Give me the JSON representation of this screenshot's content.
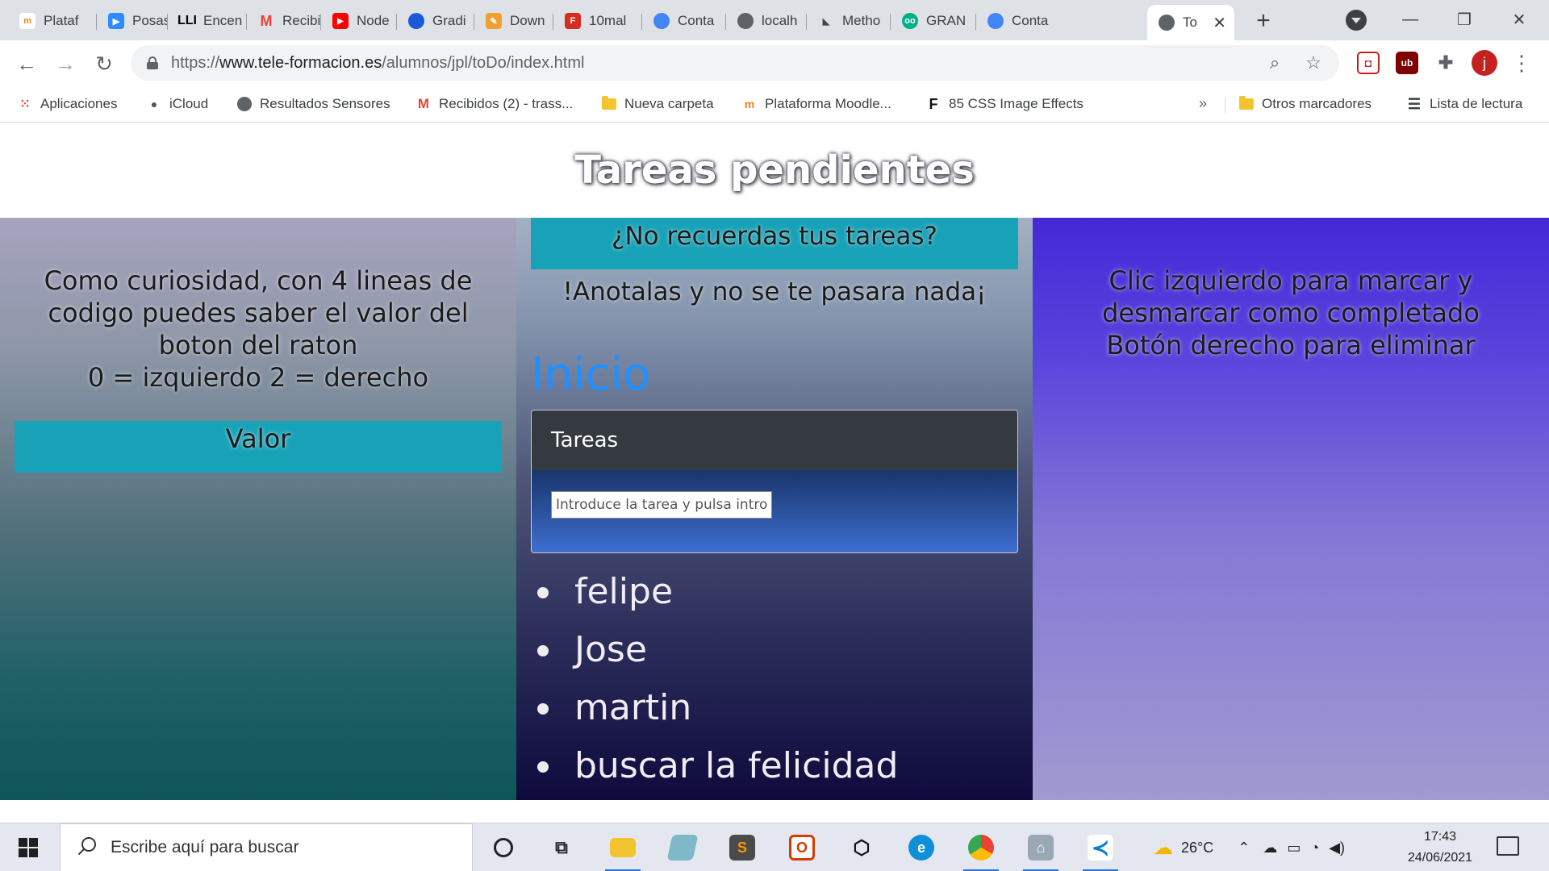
{
  "browser": {
    "tabs": [
      {
        "label": "Plataf",
        "icon": "moodle-icon",
        "color": "#f98012"
      },
      {
        "label": "Posas",
        "icon": "zoom-icon",
        "color": "#2d8cff"
      },
      {
        "label": "Encen",
        "icon": "lli-icon",
        "color": "#000000"
      },
      {
        "label": "Recibi",
        "icon": "gmail-icon",
        "color": "#ea4335"
      },
      {
        "label": "Node",
        "icon": "youtube-icon",
        "color": "#ff0000"
      },
      {
        "label": "Gradi",
        "icon": "gradient-icon",
        "color": "#1a5ad8"
      },
      {
        "label": "Down",
        "icon": "pencil-icon",
        "color": "#f0a030"
      },
      {
        "label": "10mal",
        "icon": "10minutemail-icon",
        "color": "#d62d20"
      },
      {
        "label": "Conta",
        "icon": "cloud-icon",
        "color": "#4285f4"
      },
      {
        "label": "localh",
        "icon": "globe-icon",
        "color": "#5f6368"
      },
      {
        "label": "Metho",
        "icon": "triangle-icon",
        "color": "#444444"
      },
      {
        "label": "GRAN",
        "icon": "tripadvisor-icon",
        "color": "#00af87"
      },
      {
        "label": "Conta",
        "icon": "cloud-icon",
        "color": "#4285f4"
      },
      {
        "label": "To",
        "icon": "globe-icon",
        "color": "#5f6368",
        "active": true
      }
    ],
    "url": {
      "prefix": "https://",
      "host": "www.tele-formacion.es",
      "path": "/alumnos/jpl/toDo/index.html"
    },
    "profile_initial": "j",
    "bookmarks": [
      {
        "label": "Aplicaciones",
        "icon": "apps-grid-icon"
      },
      {
        "label": "iCloud",
        "icon": "apple-icon"
      },
      {
        "label": "Resultados Sensores",
        "icon": "globe-icon"
      },
      {
        "label": "Recibidos (2) - trass...",
        "icon": "gmail-icon"
      },
      {
        "label": "Nueva carpeta",
        "icon": "folder-icon"
      },
      {
        "label": "Plataforma Moodle...",
        "icon": "moodle-icon"
      },
      {
        "label": "85 CSS Image Effects",
        "icon": "f-icon"
      }
    ],
    "bookmarks_overflow": "»",
    "other_bookmarks": "Otros marcadores",
    "reading_list": "Lista de lectura"
  },
  "page": {
    "title": "Tareas pendientes",
    "left": {
      "lines": [
        "Como curiosidad, con 4 lineas de codigo puedes saber el valor del boton del raton",
        "0 = izquierdo 2 = derecho"
      ],
      "value_label": "Valor"
    },
    "middle": {
      "banner": "¿No recuerdas tus tareas?",
      "subtitle": "!Anotalas y no se te pasara nada¡",
      "heading": "Inicio",
      "card_title": "Tareas",
      "input_placeholder": "Introduce la tarea y pulsa intro",
      "tasks": [
        "felipe",
        "Jose",
        "martin",
        "buscar la felicidad"
      ]
    },
    "right": {
      "lines": [
        "Clic izquierdo para marcar y desmarcar como completado",
        "Botón derecho para eliminar"
      ]
    },
    "colors": {
      "accent_box": "#17a2b8",
      "heading_blue": "#1e90ff",
      "card_header": "#343a40"
    }
  },
  "taskbar": {
    "search_placeholder": "Escribe aquí para buscar",
    "weather": "26°C",
    "time": "17:43",
    "date": "24/06/2021"
  }
}
